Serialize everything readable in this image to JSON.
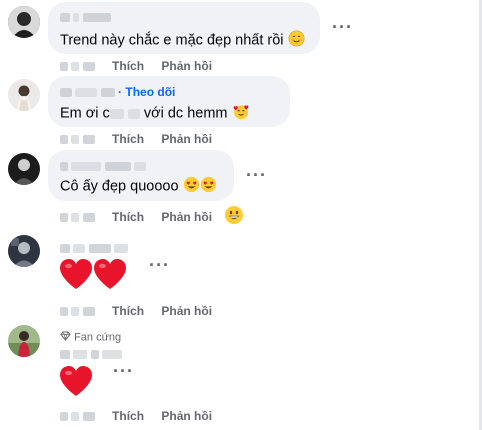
{
  "comments": [
    {
      "author": "",
      "text": "Trend này chắc e mặc đẹp nhất rồi",
      "like_label": "Thích",
      "reply_label": "Phản hồi",
      "more_label": "···"
    },
    {
      "author": "",
      "follow_label": "· Theo dõi",
      "text_prefix": "Em ơi c",
      "text_suffix": " với dc hemm",
      "like_label": "Thích",
      "reply_label": "Phản hồi",
      "more_label": "···"
    },
    {
      "author": "",
      "text": "Cô ấy đẹp quoooo",
      "like_label": "Thích",
      "reply_label": "Phản hồi",
      "more_label": "···"
    },
    {
      "author": "",
      "like_label": "Thích",
      "reply_label": "Phản hồi",
      "more_label": "···"
    },
    {
      "badge": "Fan cứng",
      "author": "",
      "like_label": "Thích",
      "reply_label": "Phản hồi",
      "more_label": "···"
    }
  ],
  "colors": {
    "follow": "#0866ff",
    "bubble": "#f0f2f5",
    "muted": "#65676b",
    "heart": "#e8142b"
  },
  "icons": [
    "smiling-face-icon",
    "smiling-face-with-hearts-icon",
    "heart-eyes-icon",
    "grinning-face-icon",
    "heart-icon",
    "diamond-icon"
  ]
}
